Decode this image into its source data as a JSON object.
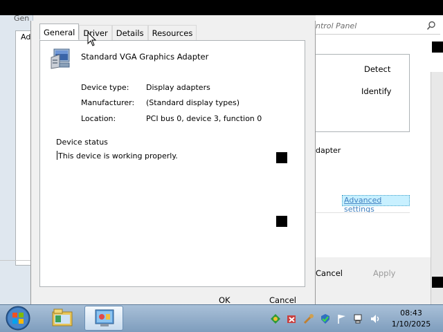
{
  "background_window": {
    "title_fragment": "Gen",
    "inner_label_fragment": "Ad",
    "search_placeholder": "ntrol Panel",
    "detect_label": "Detect",
    "identify_label": "Identify",
    "adapter_fragment": "dapter",
    "advanced_settings_label": "Advanced settings",
    "cancel_label": "Cancel",
    "apply_label": "Apply"
  },
  "dialog": {
    "tabs": [
      {
        "label": "General",
        "active": true
      },
      {
        "label": "Driver",
        "active": false
      },
      {
        "label": "Details",
        "active": false
      },
      {
        "label": "Resources",
        "active": false
      }
    ],
    "device_name": "Standard VGA Graphics Adapter",
    "properties": [
      {
        "label": "Device type:",
        "value": "Display adapters"
      },
      {
        "label": "Manufacturer:",
        "value": "(Standard display types)"
      },
      {
        "label": "Location:",
        "value": "PCI bus 0, device 3, function 0"
      }
    ],
    "device_status_label": "Device status",
    "device_status_text": "This device is working properly.",
    "ok_label": "OK",
    "cancel_label": "Cancel"
  },
  "taskbar": {
    "clock_time": "08:43",
    "clock_date": "1/10/2025"
  },
  "icons": {
    "device": "display-adapter-icon",
    "start": "windows-start-orb",
    "search": "search-icon"
  }
}
